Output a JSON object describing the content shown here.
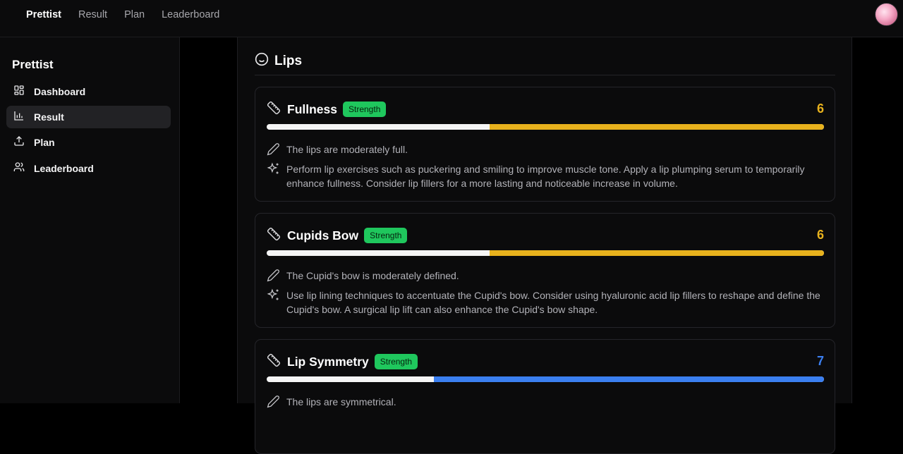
{
  "topnav": {
    "brand": "Prettist",
    "links": [
      "Result",
      "Plan",
      "Leaderboard"
    ]
  },
  "sidebar": {
    "title": "Prettist",
    "items": [
      {
        "label": "Dashboard",
        "icon": "grid-icon"
      },
      {
        "label": "Result",
        "icon": "bar-chart-icon",
        "active": true
      },
      {
        "label": "Plan",
        "icon": "upload-icon"
      },
      {
        "label": "Leaderboard",
        "icon": "users-icon"
      }
    ]
  },
  "section": {
    "title": "Lips",
    "icon": "smile-icon"
  },
  "cards": [
    {
      "title": "Fullness",
      "badge": "Strength",
      "score": "6",
      "score_color": "#e8b21d",
      "progress": 0.6,
      "observation": "The lips are moderately full.",
      "advice": "Perform lip exercises such as puckering and smiling to improve muscle tone. Apply a lip plumping serum to temporarily enhance fullness. Consider lip fillers for a more lasting and noticeable increase in volume."
    },
    {
      "title": "Cupids Bow",
      "badge": "Strength",
      "score": "6",
      "score_color": "#e8b21d",
      "progress": 0.6,
      "observation": "The Cupid's bow is moderately defined.",
      "advice": "Use lip lining techniques to accentuate the Cupid's bow. Consider using hyaluronic acid lip fillers to reshape and define the Cupid's bow. A surgical lip lift can also enhance the Cupid's bow shape."
    },
    {
      "title": "Lip Symmetry",
      "badge": "Strength",
      "score": "7",
      "score_color": "#3b7ff0",
      "progress": 0.7,
      "observation": "The lips are symmetrical."
    }
  ],
  "colors": {
    "accent_yellow": "#e8b21d",
    "accent_blue": "#3b7ff0",
    "badge_green": "#1fc75d"
  }
}
